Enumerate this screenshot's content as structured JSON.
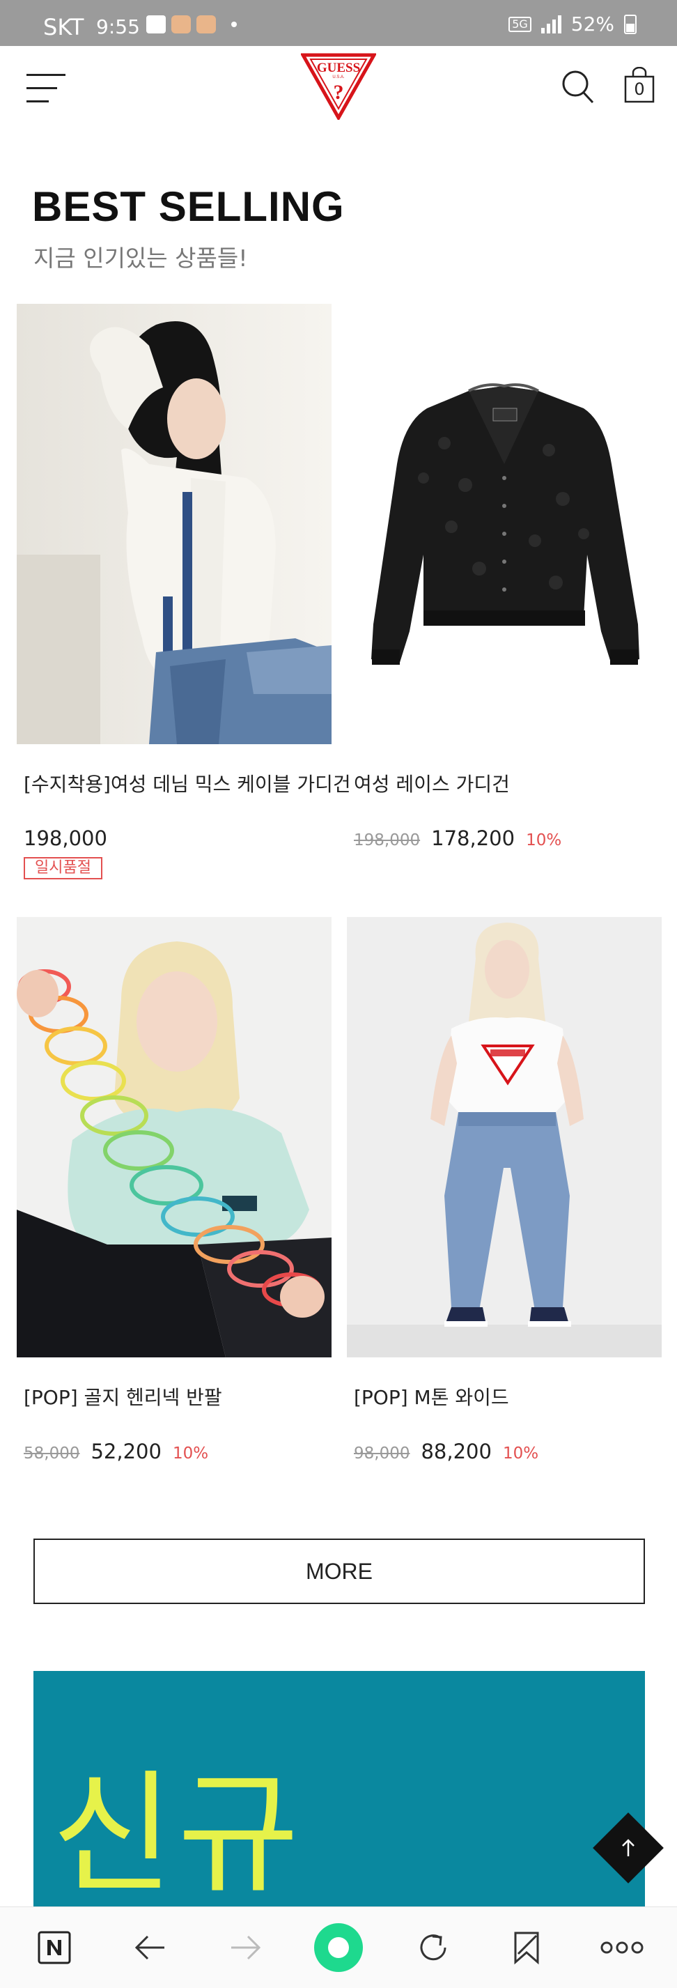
{
  "status_bar": {
    "carrier": "SKT",
    "time": "9:55",
    "network": "5G",
    "battery": "52%"
  },
  "header": {
    "cart_count": "0"
  },
  "section": {
    "title": "BEST SELLING",
    "subtitle": "지금 인기있는 상품들!"
  },
  "products": [
    {
      "name": "[수지착용]여성 데님 믹스 케이블 가디건",
      "original_price": "",
      "price": "198,000",
      "discount": "",
      "badge": "일시품절"
    },
    {
      "name": "여성 레이스 가디건",
      "original_price": "198,000",
      "price": "178,200",
      "discount": "10%",
      "badge": ""
    },
    {
      "name": "[POP] 골지 헨리넥 반팔",
      "original_price": "58,000",
      "price": "52,200",
      "discount": "10%",
      "badge": ""
    },
    {
      "name": "[POP] M톤 와이드",
      "original_price": "98,000",
      "price": "88,200",
      "discount": "10%",
      "badge": ""
    }
  ],
  "more_label": "MORE",
  "banner": {
    "text": "신규",
    "background": "#0a889f",
    "text_color": "#e6f24a"
  },
  "colors": {
    "discount": "#e35050",
    "accent_green": "#1ed98e"
  },
  "icons": [
    "menu-icon",
    "guess-logo",
    "search-icon",
    "bag-icon",
    "arrow-up-icon",
    "naver-icon",
    "back-arrow-icon",
    "forward-arrow-icon",
    "refresh-icon",
    "bookmark-icon",
    "more-dots-icon"
  ]
}
